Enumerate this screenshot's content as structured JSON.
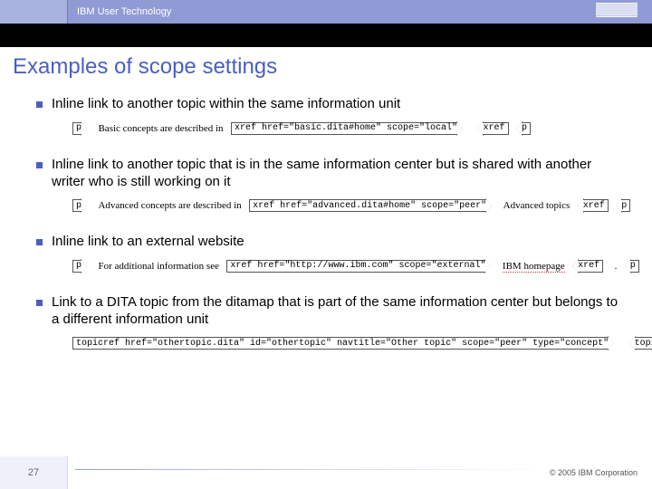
{
  "header": {
    "title": "IBM User Technology",
    "logo_alt": "IBM"
  },
  "heading": "Examples of scope settings",
  "bullets": [
    {
      "text": "Inline link to another topic within the same information unit",
      "row": {
        "open_p": "p",
        "lead": "Basic concepts are described in",
        "xref_open": "xref href=\"basic.dita#home\" scope=\"local\"",
        "content": " ",
        "xref_close": "xref",
        "close_p": "p"
      }
    },
    {
      "text": "Inline link to another topic that is in the same information center but is shared with another writer who is still working on it",
      "row": {
        "open_p": "p",
        "lead": "Advanced concepts are described in",
        "xref_open": "xref href=\"advanced.dita#home\" scope=\"peer\"",
        "content": "Advanced topics",
        "xref_close": "xref",
        "close_p": "p"
      }
    },
    {
      "text": "Inline link to an external website",
      "row": {
        "open_p": "p",
        "lead": "For additional information see",
        "xref_open": "xref href=\"http://www.ibm.com\" scope=\"external\"",
        "content": "IBM homepage",
        "xref_close": "xref",
        "close_p": "p"
      }
    },
    {
      "text": "Link to a DITA topic from the ditamap that is part of the same information center but belongs to a different information unit",
      "row": {
        "open_p": "",
        "lead": "",
        "xref_open": "topicref href=\"othertopic.dita\" id=\"othertopic\" navtitle=\"Other topic\" scope=\"peer\" type=\"concept\"",
        "content": " ",
        "xref_close": "topicref",
        "close_p": ""
      }
    }
  ],
  "footer": {
    "page": "27",
    "copyright": "© 2005 IBM Corporation"
  }
}
